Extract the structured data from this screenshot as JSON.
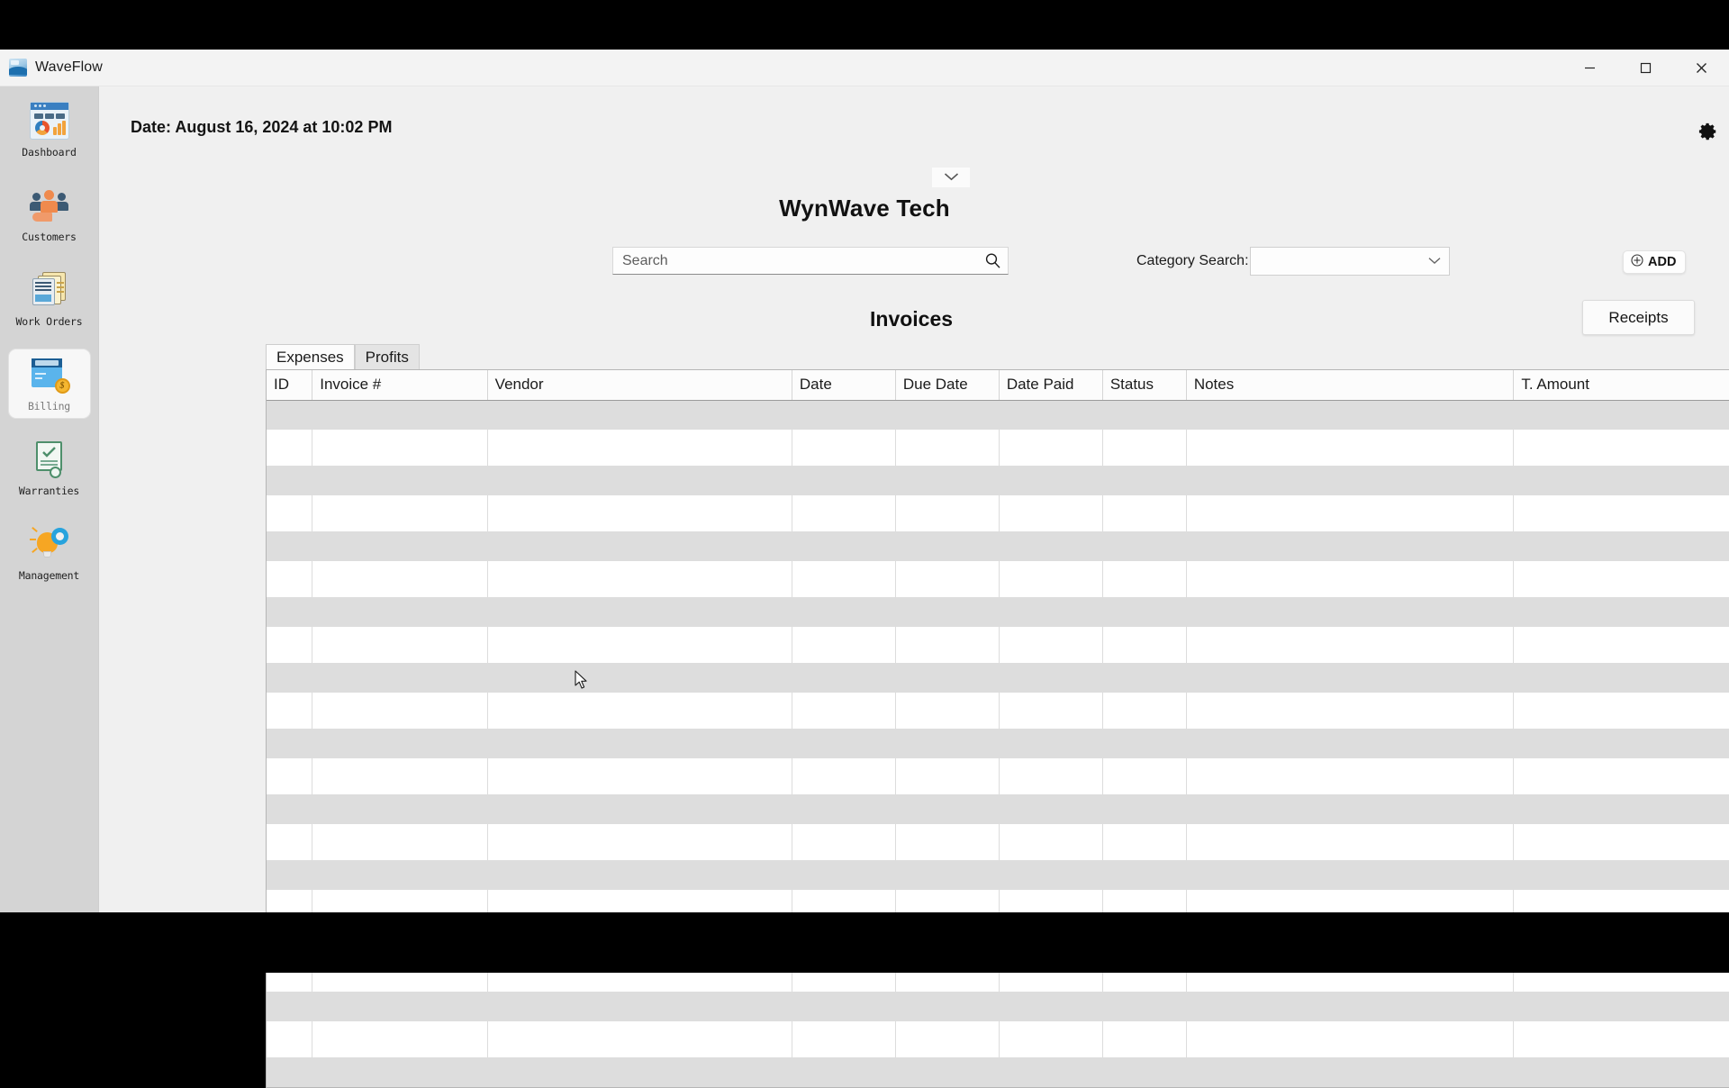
{
  "window": {
    "app_title": "WaveFlow",
    "app_icon": "wave-app-icon",
    "minimize_label": "Minimize",
    "maximize_label": "Maximize",
    "close_label": "Close"
  },
  "sidebar": {
    "items": [
      {
        "label": "Dashboard",
        "icon": "dashboard-icon",
        "active": false
      },
      {
        "label": "Customers",
        "icon": "customers-icon",
        "active": false
      },
      {
        "label": "Work Orders",
        "icon": "work-orders-icon",
        "active": false
      },
      {
        "label": "Billing",
        "icon": "billing-icon",
        "active": true
      },
      {
        "label": "Warranties",
        "icon": "warranties-icon",
        "active": false
      },
      {
        "label": "Management",
        "icon": "management-icon",
        "active": false
      }
    ]
  },
  "header": {
    "date_text": "Date: August 16, 2024 at 10:02 PM",
    "company_title": "WynWave Tech",
    "collapse_icon": "chevron-down-icon",
    "gear_icon": "gear-icon",
    "refresh_icon": "refresh-icon"
  },
  "search": {
    "placeholder": "Search",
    "value": "",
    "search_icon": "search-icon",
    "category_label": "Category Search:",
    "category_value": "",
    "category_caret_icon": "chevron-down-icon"
  },
  "toolbar": {
    "add_label": "ADD",
    "add_icon": "plus-circle-icon"
  },
  "section": {
    "title": "Invoices",
    "receipts_label": "Receipts"
  },
  "tabs": [
    {
      "label": "Expenses",
      "active": true
    },
    {
      "label": "Profits",
      "active": false
    }
  ],
  "table": {
    "columns": [
      {
        "label": "ID",
        "width": "3.0%"
      },
      {
        "label": "Invoice #",
        "width": "11.5%"
      },
      {
        "label": "Vendor",
        "width": "20.0%"
      },
      {
        "label": "Date",
        "width": "6.8%"
      },
      {
        "label": "Due Date",
        "width": "6.8%"
      },
      {
        "label": "Date Paid",
        "width": "6.8%"
      },
      {
        "label": "Status",
        "width": "5.5%"
      },
      {
        "label": "Notes",
        "width": "21.5%"
      },
      {
        "label": "T. Amount",
        "width": "18.1%"
      }
    ],
    "rows": [
      {
        "cells": [
          "",
          "",
          "",
          "",
          "",
          "",
          "",
          "",
          ""
        ]
      },
      {
        "cells": [
          "",
          "",
          "",
          "",
          "",
          "",
          "",
          "",
          ""
        ]
      },
      {
        "cells": [
          "",
          "",
          "",
          "",
          "",
          "",
          "",
          "",
          ""
        ]
      },
      {
        "cells": [
          "",
          "",
          "",
          "",
          "",
          "",
          "",
          "",
          ""
        ]
      },
      {
        "cells": [
          "",
          "",
          "",
          "",
          "",
          "",
          "",
          "",
          ""
        ]
      },
      {
        "cells": [
          "",
          "",
          "",
          "",
          "",
          "",
          "",
          "",
          ""
        ]
      },
      {
        "cells": [
          "",
          "",
          "",
          "",
          "",
          "",
          "",
          "",
          ""
        ]
      },
      {
        "cells": [
          "",
          "",
          "",
          "",
          "",
          "",
          "",
          "",
          ""
        ]
      },
      {
        "cells": [
          "",
          "",
          "",
          "",
          "",
          "",
          "",
          "",
          ""
        ]
      },
      {
        "cells": [
          "",
          "",
          "",
          "",
          "",
          "",
          "",
          "",
          ""
        ]
      },
      {
        "cells": [
          "",
          "",
          "",
          "",
          "",
          "",
          "",
          "",
          ""
        ]
      },
      {
        "cells": [
          "",
          "",
          "",
          "",
          "",
          "",
          "",
          "",
          ""
        ]
      },
      {
        "cells": [
          "",
          "",
          "",
          "",
          "",
          "",
          "",
          "",
          ""
        ]
      },
      {
        "cells": [
          "",
          "",
          "",
          "",
          "",
          "",
          "",
          "",
          ""
        ]
      },
      {
        "cells": [
          "",
          "",
          "",
          "",
          "",
          "",
          "",
          "",
          ""
        ]
      },
      {
        "cells": [
          "",
          "",
          "",
          "",
          "",
          "",
          "",
          "",
          ""
        ]
      },
      {
        "cells": [
          "",
          "",
          "",
          "",
          "",
          "",
          "",
          "",
          ""
        ]
      },
      {
        "cells": [
          "",
          "",
          "",
          "",
          "",
          "",
          "",
          "",
          ""
        ]
      },
      {
        "cells": [
          "",
          "",
          "",
          "",
          "",
          "",
          "",
          "",
          ""
        ]
      },
      {
        "cells": [
          "",
          "",
          "",
          "",
          "",
          "",
          "",
          "",
          ""
        ]
      },
      {
        "cells": [
          "",
          "",
          "",
          "",
          "",
          "",
          "",
          "",
          ""
        ]
      }
    ]
  },
  "colors": {
    "window_bg": "#f0f0f0",
    "sidebar_bg": "#d4d4d4",
    "row_stripe": "#dddddd",
    "row_plain": "#ffffff",
    "accent_blue": "#2f7fc0",
    "desktop": "#000000"
  }
}
